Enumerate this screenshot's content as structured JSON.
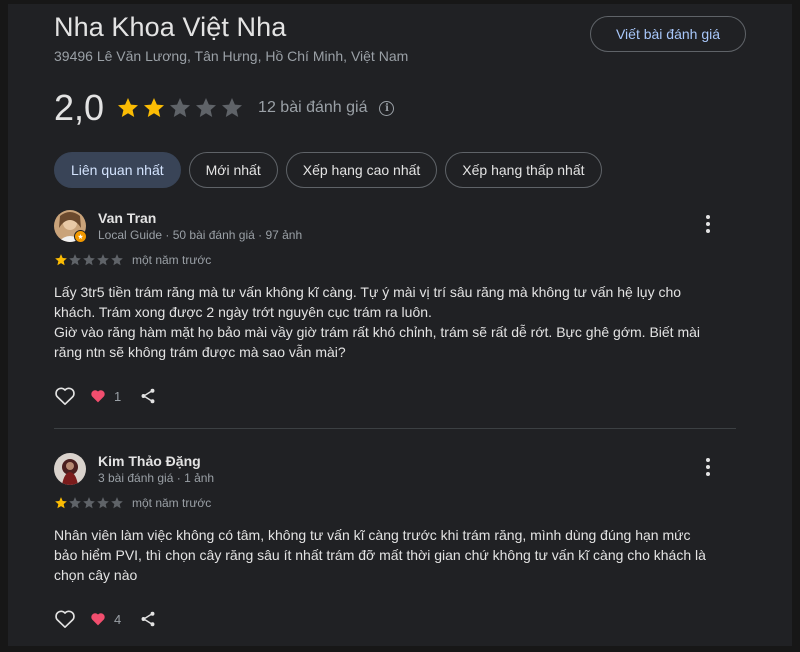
{
  "place": {
    "name": "Nha Khoa Việt Nha",
    "address": "39496 Lê Văn Lương, Tân Hưng, Hồ Chí Minh, Việt Nam",
    "write_review_label": "Viết bài đánh giá",
    "rating": "2,0",
    "rating_stars": 2,
    "review_count": "12 bài đánh giá",
    "info_icon": "info-icon"
  },
  "sort_chips": [
    {
      "label": "Liên quan nhất",
      "active": true
    },
    {
      "label": "Mới nhất",
      "active": false
    },
    {
      "label": "Xếp hạng cao nhất",
      "active": false
    },
    {
      "label": "Xếp hạng thấp nhất",
      "active": false
    }
  ],
  "reviews": [
    {
      "author": "Van Tran",
      "meta": "Local Guide · 50 bài đánh giá · 97 ảnh",
      "stars": 1,
      "date": "một năm trước",
      "text": [
        "Lấy 3tr5 tiền trám răng mà tư vấn không kĩ càng. Tự ý mài vị trí sâu răng mà không tư vấn hệ lụy cho",
        "khách. Trám xong được 2 ngày trớt nguyên cục trám ra luôn.",
        "Giờ vào răng hàm mặt họ bảo mài vầy giờ trám rất khó chỉnh, trám sẽ rất dễ rớt. Bực ghê gớm. Biết mài",
        "răng ntn sẽ không trám được mà sao vẫn mài?"
      ],
      "likes": "1"
    },
    {
      "author": "Kim Thảo Đặng",
      "meta": "3 bài đánh giá · 1 ảnh",
      "stars": 1,
      "date": "một năm trước",
      "text": [
        "Nhân viên làm việc không có tâm, không tư vấn kĩ càng trước khi trám răng, mình dùng đúng hạn mức",
        "bảo hiểm PVI, thì chọn cây răng sâu ít nhất trám đỡ mất thời gian chứ không tư vấn kĩ càng cho khách là",
        "chọn cây nào"
      ],
      "likes": "4"
    }
  ],
  "colors": {
    "star_filled": "#fbbc04",
    "star_empty": "#5f6368",
    "heart_red": "#f14e6e",
    "accent": "#a8c7fa"
  }
}
